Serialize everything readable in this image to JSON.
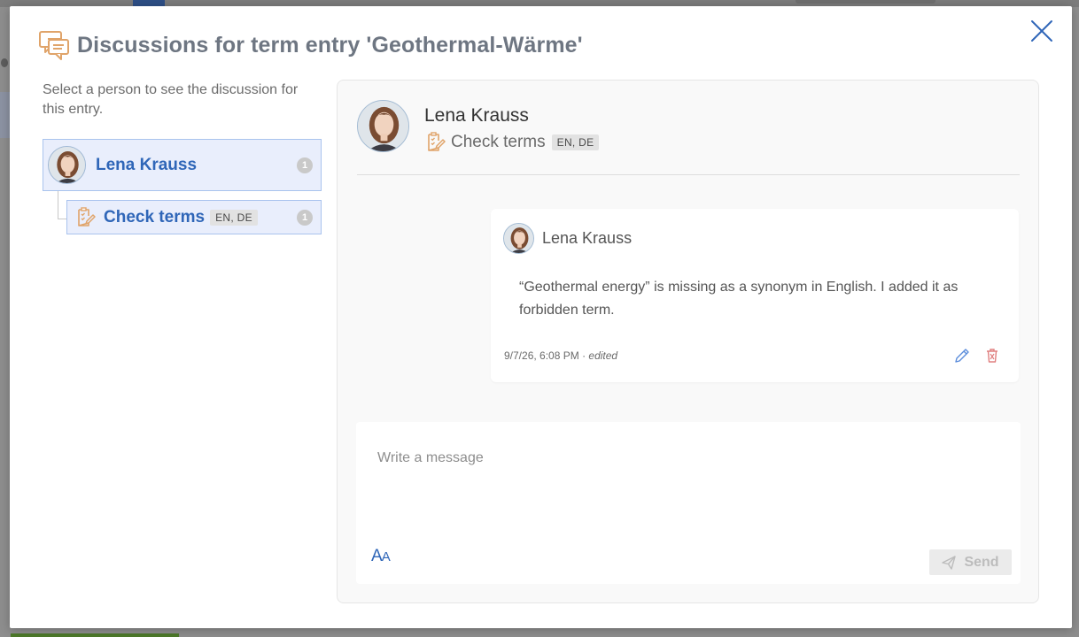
{
  "modal": {
    "title": "Discussions for term entry 'Geothermal-Wärme'"
  },
  "left_pane": {
    "intro": "Select a person to see the discussion for this entry.",
    "person": {
      "name": "Lena Krauss",
      "count": "1"
    },
    "task": {
      "label": "Check terms",
      "languages": "EN, DE",
      "count": "1"
    }
  },
  "conversation": {
    "author": "Lena Krauss",
    "task_label": "Check terms",
    "task_languages": "EN, DE"
  },
  "message": {
    "author": "Lena Krauss",
    "body": "“Geothermal energy” is missing as a synonym in English. I added it as forbidden term.",
    "timestamp": "9/7/26, 6:08 PM",
    "separator": " · ",
    "edited_label": "edited"
  },
  "composer": {
    "placeholder": "Write a message",
    "format_big": "A",
    "format_small": "A",
    "send_label": "Send"
  },
  "colors": {
    "accent": "#2f66b8",
    "title_gray": "#6e7682",
    "icon_orange": "#e0a46a",
    "delete_red": "#e08080"
  },
  "icons": {
    "header": "discussion-icon",
    "close": "close-icon",
    "task": "checklist-pencil-icon",
    "edit": "pencil-icon",
    "delete": "trash-icon",
    "send": "paper-plane-icon",
    "format": "text-format-icon"
  }
}
